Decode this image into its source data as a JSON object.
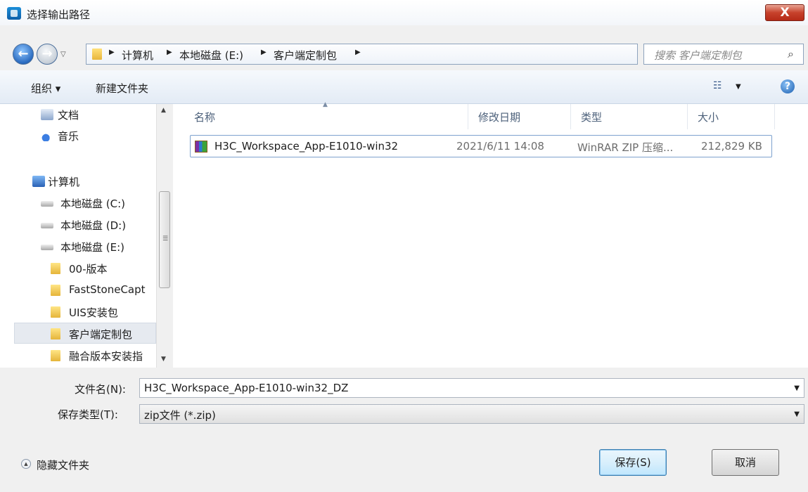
{
  "window": {
    "title": "选择输出路径",
    "close_label": "X"
  },
  "address": {
    "crumbs": [
      "计算机",
      "本地磁盘 (E:)",
      "客户端定制包"
    ],
    "search_placeholder": "搜索 客户端定制包"
  },
  "toolbar": {
    "organize_label": "组织 ▾",
    "new_folder_label": "新建文件夹",
    "help_label": "?"
  },
  "nav": {
    "items": [
      {
        "label": "文档",
        "icon": "document-icon"
      },
      {
        "label": "音乐",
        "icon": "music-icon"
      },
      {
        "label": "计算机",
        "icon": "computer-icon"
      },
      {
        "label": "本地磁盘 (C:)",
        "icon": "drive-icon"
      },
      {
        "label": "本地磁盘 (D:)",
        "icon": "drive-icon"
      },
      {
        "label": "本地磁盘 (E:)",
        "icon": "drive-icon"
      },
      {
        "label": "00-版本",
        "icon": "folder-icon"
      },
      {
        "label": "FastStoneCapt",
        "icon": "folder-icon"
      },
      {
        "label": "UIS安装包",
        "icon": "folder-icon"
      },
      {
        "label": "客户端定制包",
        "icon": "folder-icon",
        "selected": true
      },
      {
        "label": "融合版本安装指",
        "icon": "folder-icon"
      }
    ]
  },
  "files": {
    "columns": [
      "名称",
      "修改日期",
      "类型",
      "大小"
    ],
    "rows": [
      {
        "name": "H3C_Workspace_App-E1010-win32",
        "modified": "2021/6/11 14:08",
        "type": "WinRAR ZIP 压缩...",
        "size": "212,829 KB",
        "icon": "winrar-archive-icon"
      }
    ]
  },
  "form": {
    "filename_label": "文件名(N):",
    "filename_value": "H3C_Workspace_App-E1010-win32_DZ",
    "filetype_label": "保存类型(T):",
    "filetype_value": "zip文件 (*.zip)"
  },
  "footer": {
    "hide_folders_label": "隐藏文件夹",
    "save_label": "保存(S)",
    "cancel_label": "取消"
  }
}
